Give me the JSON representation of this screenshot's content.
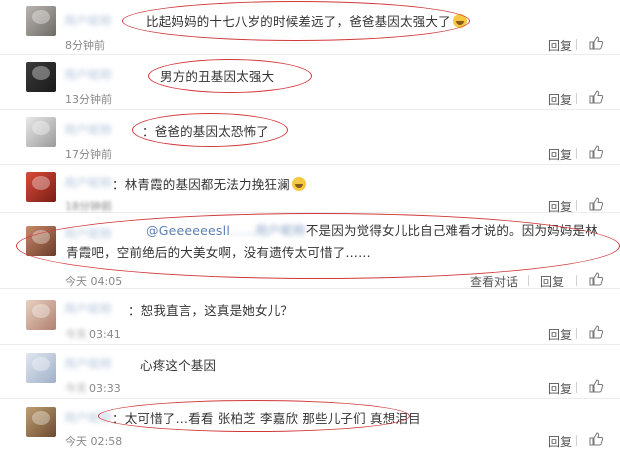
{
  "comments": [
    {
      "text": "比起妈妈的十七八岁的时候差远了，爸爸基因太强大了",
      "emoji": true,
      "time": "8分钟前",
      "reply": "回复"
    },
    {
      "text": "男方的丑基因太强大",
      "time": "13分钟前",
      "reply": "回复"
    },
    {
      "prefix": "：",
      "text": "爸爸的基因太恐怖了",
      "time": "17分钟前",
      "reply": "回复"
    },
    {
      "prefix": "：",
      "text": "林青霞的基因都无法力挽狂澜",
      "emoji": true,
      "time": "18分钟前",
      "reply": "回复"
    },
    {
      "mention": "@Geeeeeesll",
      "text": "不是因为觉得女儿比自己难看才说的。因为妈妈是林青霞吧，空前绝后的大美女啊，没有遗传太可惜了……",
      "time_day": "今天",
      "time": "04:05",
      "extra": "查看对话",
      "reply": "回复"
    },
    {
      "prefix": "：",
      "text": "恕我直言，这真是她女儿？",
      "time_day": "今天",
      "time": "03:41",
      "reply": "回复"
    },
    {
      "text": "心疼这个基因",
      "time_day": "今天",
      "time": "03:33",
      "reply": "回复"
    },
    {
      "prefix": "：",
      "text": "太可惜了…看看 张柏芝 李嘉欣 那些儿子们 真想泪目",
      "time_day": "今天",
      "time": "02:58",
      "reply": "回复"
    }
  ],
  "hidden_username": "用户昵称",
  "hidden_time_prefix": "今天",
  "like_icon": "thumbs-up-icon",
  "colors": {
    "circle": "#d0383a",
    "link": "#5a7fb5"
  }
}
